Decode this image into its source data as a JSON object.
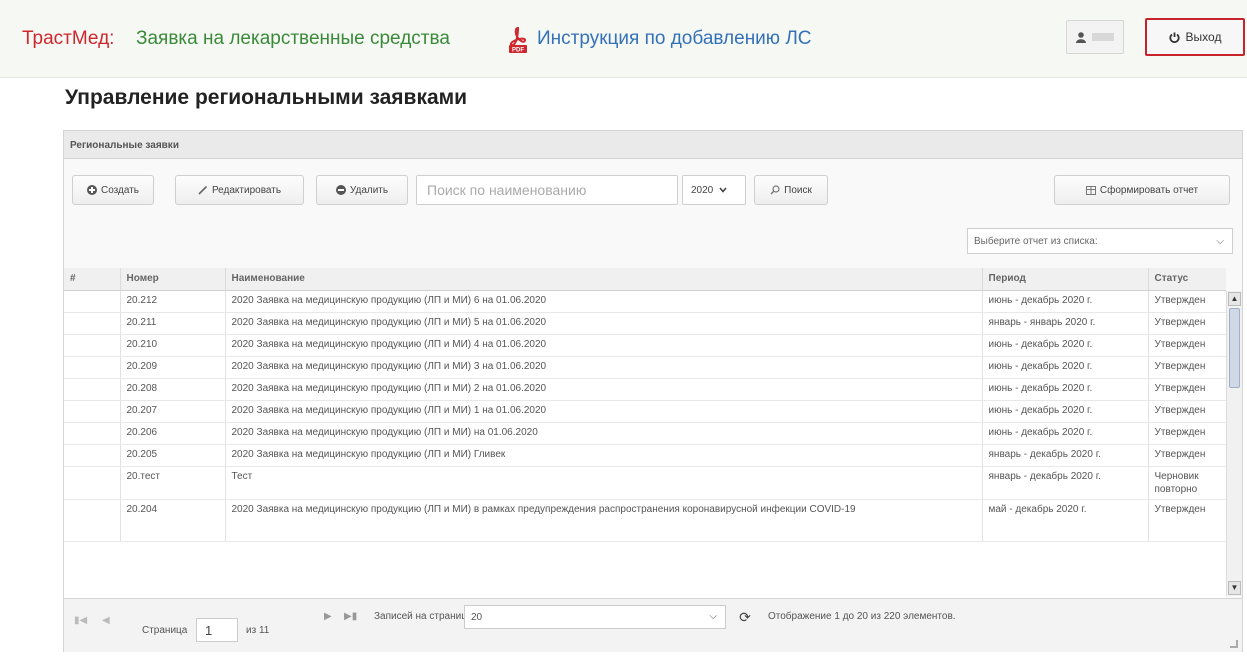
{
  "header": {
    "brand": "ТрастМед:",
    "app_title": "Заявка на лекарственные средства",
    "instruction_link": "Инструкция по добавлению ЛС",
    "logout_label": "Выход"
  },
  "page": {
    "title": "Управление региональными заявками"
  },
  "panel": {
    "title": "Региональные заявки",
    "toolbar": {
      "create_label": "Создать",
      "edit_label": "Редактировать",
      "delete_label": "Удалить",
      "search_placeholder": "Поиск по наименованию",
      "year_value": "2020",
      "search_button_label": "Поиск",
      "report_button_label": "Сформировать отчет",
      "report_select_placeholder": "Выберите отчет из списка:"
    },
    "table": {
      "columns": [
        "#",
        "Номер",
        "Наименование",
        "Период",
        "Статус"
      ],
      "rows": [
        {
          "num": "",
          "number": "20.212",
          "name": "2020 Заявка на медицинскую продукцию (ЛП и МИ) 6 на 01.06.2020",
          "period": "июнь - декабрь 2020 г.",
          "status": "Утвержден"
        },
        {
          "num": "",
          "number": "20.211",
          "name": "2020 Заявка на медицинскую продукцию (ЛП и МИ) 5 на 01.06.2020",
          "period": "январь - январь 2020 г.",
          "status": "Утвержден"
        },
        {
          "num": "",
          "number": "20.210",
          "name": "2020 Заявка на медицинскую продукцию (ЛП и МИ) 4 на 01.06.2020",
          "period": "июнь - декабрь 2020 г.",
          "status": "Утвержден"
        },
        {
          "num": "",
          "number": "20.209",
          "name": "2020 Заявка на медицинскую продукцию (ЛП и МИ) 3 на 01.06.2020",
          "period": "июнь - декабрь 2020 г.",
          "status": "Утвержден"
        },
        {
          "num": "",
          "number": "20.208",
          "name": "2020 Заявка на медицинскую продукцию (ЛП и МИ) 2 на 01.06.2020",
          "period": "июнь - декабрь 2020 г.",
          "status": "Утвержден"
        },
        {
          "num": "",
          "number": "20.207",
          "name": "2020 Заявка на медицинскую продукцию (ЛП и МИ) 1 на 01.06.2020",
          "period": "июнь - декабрь 2020 г.",
          "status": "Утвержден"
        },
        {
          "num": "",
          "number": "20.206",
          "name": "2020 Заявка на медицинскую продукцию (ЛП и МИ) на 01.06.2020",
          "period": "июнь - декабрь 2020 г.",
          "status": "Утвержден"
        },
        {
          "num": "",
          "number": "20.205",
          "name": "2020 Заявка на медицинскую продукцию (ЛП и МИ) Гливек",
          "period": "январь - декабрь 2020 г.",
          "status": "Утвержден"
        },
        {
          "num": "",
          "number": "20.тест",
          "name": "Тест",
          "period": "январь - декабрь 2020 г.",
          "status": "Черновик повторно"
        },
        {
          "num": "",
          "number": "20.204",
          "name": "2020 Заявка на медицинскую продукцию (ЛП и МИ) в рамках предупреждения распространения коронавирусной инфекции COVID-19",
          "period": "май - декабрь 2020 г.",
          "status": "Утвержден"
        }
      ]
    },
    "pager": {
      "page_label": "Страница",
      "page_value": "1",
      "of_label": "из 11",
      "page_size_label": "Записей на странице:",
      "page_size_value": "20",
      "summary": "Отображение 1 до 20 из 220 элементов."
    }
  },
  "colors": {
    "brand_red": "#d0262d",
    "title_green": "#3a8a3a",
    "link_blue": "#3471b8",
    "logout_border": "#c8232b"
  },
  "icons": [
    "pdf-icon",
    "user-icon",
    "power-icon",
    "plus-circle-icon",
    "pencil-icon",
    "minus-circle-icon",
    "search-icon",
    "table-icon",
    "refresh-icon"
  ]
}
